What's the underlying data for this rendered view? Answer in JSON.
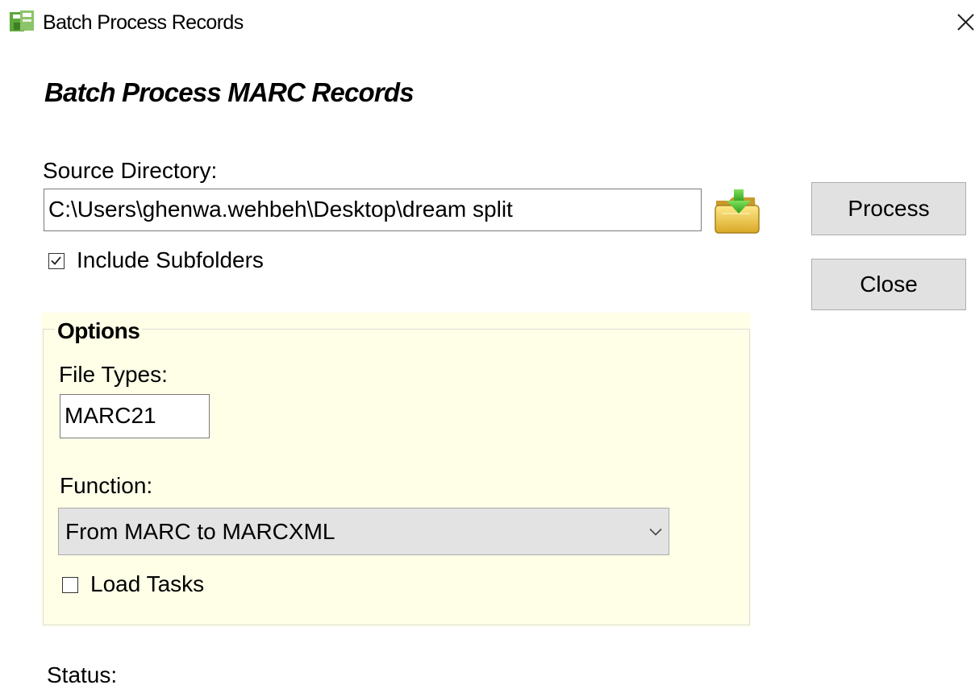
{
  "window": {
    "title": "Batch Process Records",
    "app_icon": "batch-records-icon",
    "close_icon": "close-icon"
  },
  "dialog": {
    "heading": "Batch Process MARC Records"
  },
  "source": {
    "label": "Source Directory:",
    "value": "C:\\Users\\ghenwa.wehbeh\\Desktop\\dream split",
    "browse_icon": "folder-open-icon",
    "include_subfolders": {
      "label": "Include Subfolders",
      "checked": true
    }
  },
  "buttons": {
    "process": "Process",
    "close": "Close"
  },
  "options": {
    "title": "Options",
    "file_types_label": "File Types:",
    "file_types_value": "MARC21",
    "function_label": "Function:",
    "function_value": "From MARC to MARCXML",
    "load_tasks": {
      "label": "Load Tasks",
      "checked": false
    }
  },
  "status": {
    "label": "Status:"
  },
  "colors": {
    "options_background": "#ffffe8",
    "button_face": "#e1e1e1",
    "select_face": "#e3e3e3"
  }
}
